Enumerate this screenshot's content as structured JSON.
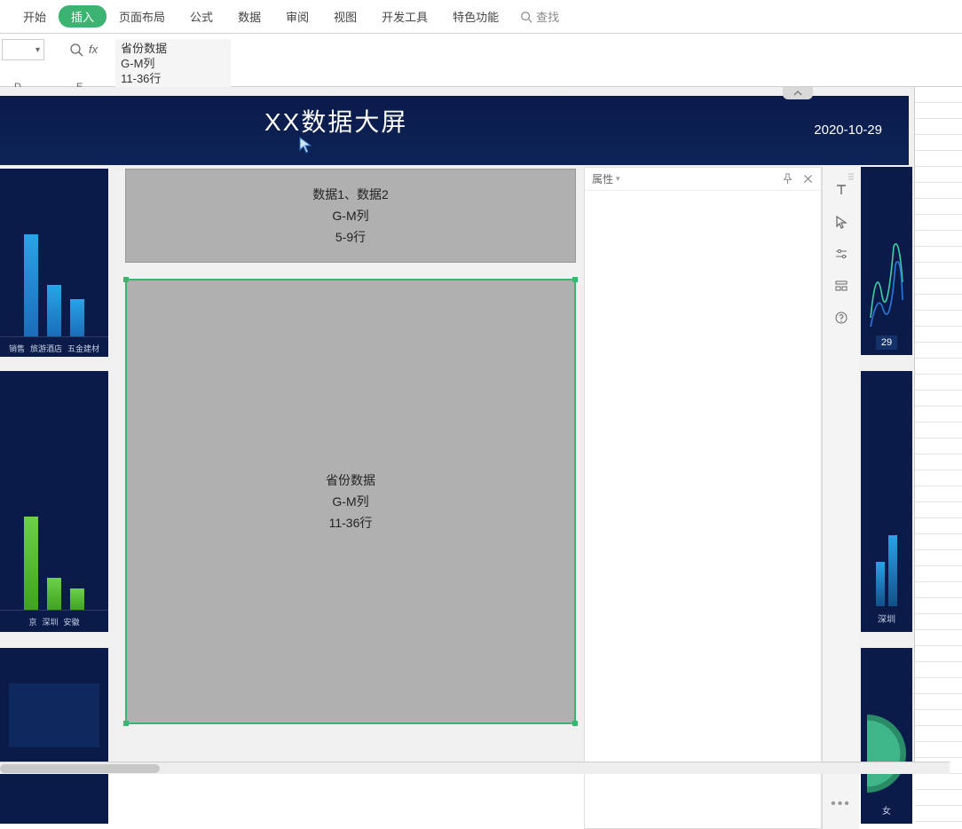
{
  "ribbon": {
    "tabs": [
      "开始",
      "插入",
      "页面布局",
      "公式",
      "数据",
      "审阅",
      "视图",
      "开发工具",
      "特色功能"
    ],
    "active_index": 1,
    "search_label": "查找"
  },
  "formula_bar": {
    "fx": "fx",
    "lines": [
      "省份数据",
      "G-M列",
      "11-36行"
    ]
  },
  "column_headers": {
    "d": "D",
    "e": "E"
  },
  "dashboard": {
    "title": "XX数据大屏",
    "date": "2020-10-29"
  },
  "left_chart_1": {
    "labels": [
      "销售",
      "旅游酒店",
      "五金建材"
    ],
    "heights": [
      115,
      58,
      42
    ]
  },
  "left_chart_2": {
    "labels": [
      "京",
      "深圳",
      "安徽"
    ],
    "heights": [
      105,
      36,
      24
    ]
  },
  "top_placeholder": {
    "l1": "数据1、数据2",
    "l2": "G-M列",
    "l3": "5-9行"
  },
  "main_placeholder": {
    "l1": "省份数据",
    "l2": "G-M列",
    "l3": "11-36行"
  },
  "properties_panel": {
    "title": "属性"
  },
  "right_chart_1": {
    "badge": "29"
  },
  "right_chart_2": {
    "label": "深圳"
  },
  "right_chart_3": {
    "label": "女"
  }
}
